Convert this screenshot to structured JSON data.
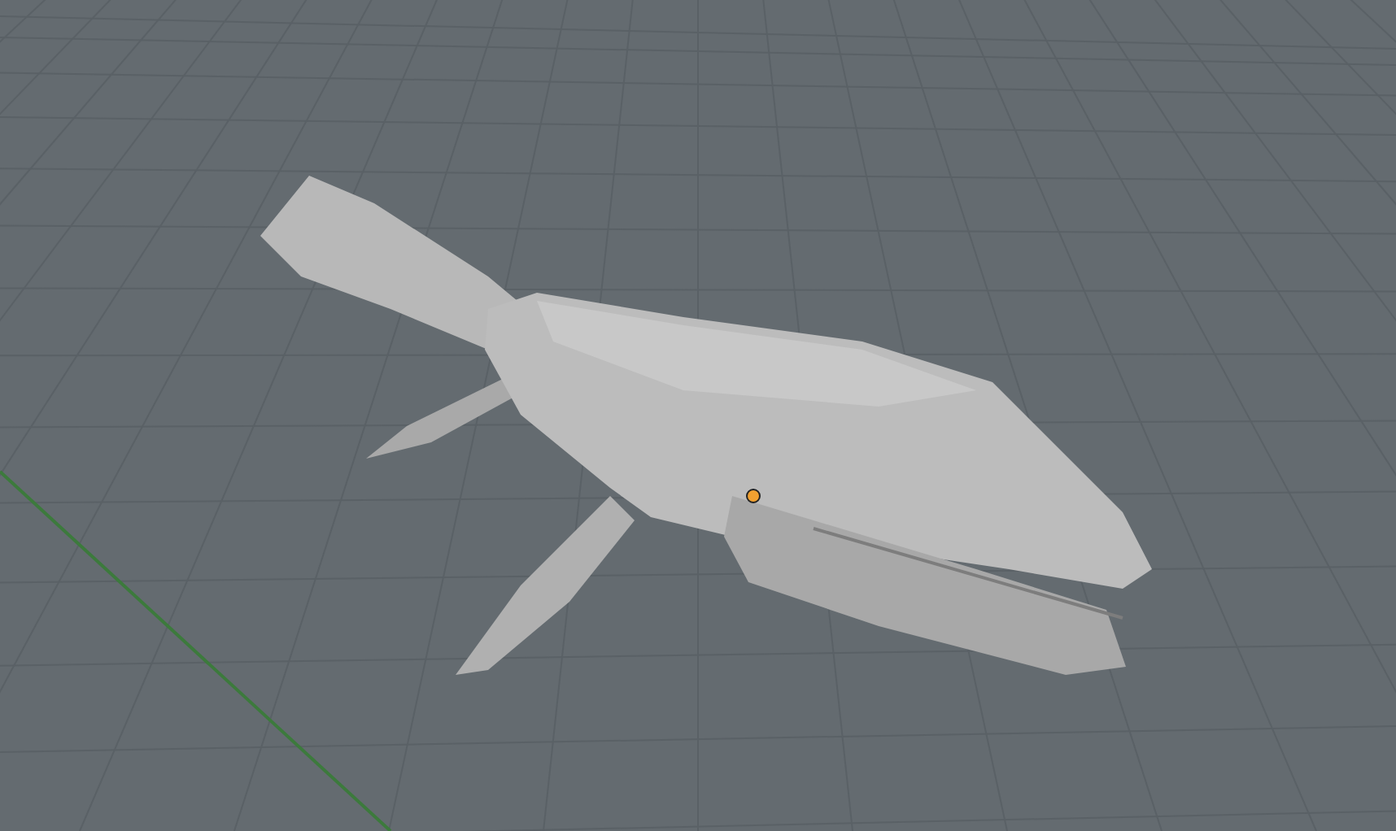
{
  "viewport": {
    "object_origin": {
      "selected": true
    }
  }
}
